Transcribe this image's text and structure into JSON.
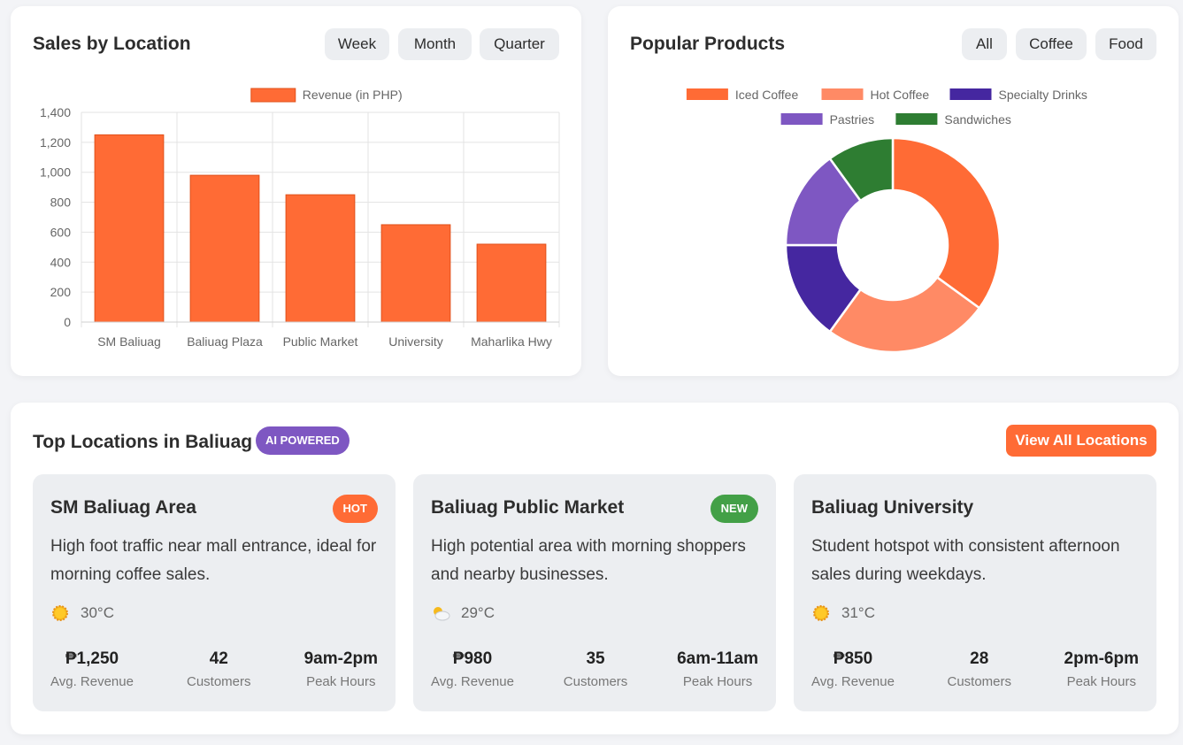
{
  "sales": {
    "title": "Sales by Location",
    "filters": [
      "Week",
      "Month",
      "Quarter"
    ]
  },
  "products": {
    "title": "Popular Products",
    "filters": [
      "All",
      "Coffee",
      "Food"
    ]
  },
  "locations": {
    "title": "Top Locations in Baliuag",
    "badge": "AI POWERED",
    "view_all_label": "View All Locations",
    "cards": [
      {
        "name": "SM Baliuag Area",
        "tag": "HOT",
        "tag_color": "#ff6b35",
        "description": "High foot traffic near mall entrance, ideal for morning coffee sales.",
        "weather_icon": "sun-icon",
        "temperature": "30°C",
        "stats": [
          {
            "value": "₱1,250",
            "label": "Avg. Revenue"
          },
          {
            "value": "42",
            "label": "Customers"
          },
          {
            "value": "9am-2pm",
            "label": "Peak Hours"
          }
        ]
      },
      {
        "name": "Baliuag Public Market",
        "tag": "NEW",
        "tag_color": "#43a047",
        "description": "High potential area with morning shoppers and nearby businesses.",
        "weather_icon": "partly-cloudy-icon",
        "temperature": "29°C",
        "stats": [
          {
            "value": "₱980",
            "label": "Avg. Revenue"
          },
          {
            "value": "35",
            "label": "Customers"
          },
          {
            "value": "6am-11am",
            "label": "Peak Hours"
          }
        ]
      },
      {
        "name": "Baliuag University",
        "tag": "",
        "tag_color": "",
        "description": "Student hotspot with consistent afternoon sales during weekdays.",
        "weather_icon": "sun-icon",
        "temperature": "31°C",
        "stats": [
          {
            "value": "₱850",
            "label": "Avg. Revenue"
          },
          {
            "value": "28",
            "label": "Customers"
          },
          {
            "value": "2pm-6pm",
            "label": "Peak Hours"
          }
        ]
      }
    ]
  },
  "chart_data": [
    {
      "type": "bar",
      "title": "",
      "categories": [
        "SM Baliuag",
        "Baliuag Plaza",
        "Public Market",
        "University",
        "Maharlika Hwy"
      ],
      "series": [
        {
          "name": "Revenue (in PHP)",
          "values": [
            1250,
            980,
            850,
            650,
            520
          ],
          "color": "#ff6b35"
        }
      ],
      "ylim": [
        0,
        1400
      ],
      "yticks": [
        0,
        200,
        400,
        600,
        800,
        1000,
        1200,
        1400
      ],
      "grid": true,
      "legend": "top"
    },
    {
      "type": "pie",
      "variant": "doughnut",
      "title": "",
      "labels": [
        "Iced Coffee",
        "Hot Coffee",
        "Specialty Drinks",
        "Pastries",
        "Sandwiches"
      ],
      "values": [
        35,
        25,
        15,
        15,
        10
      ],
      "colors": [
        "#ff6b35",
        "#ff8a65",
        "#4527a0",
        "#7e57c2",
        "#2e7d32"
      ],
      "legend": "top"
    }
  ]
}
